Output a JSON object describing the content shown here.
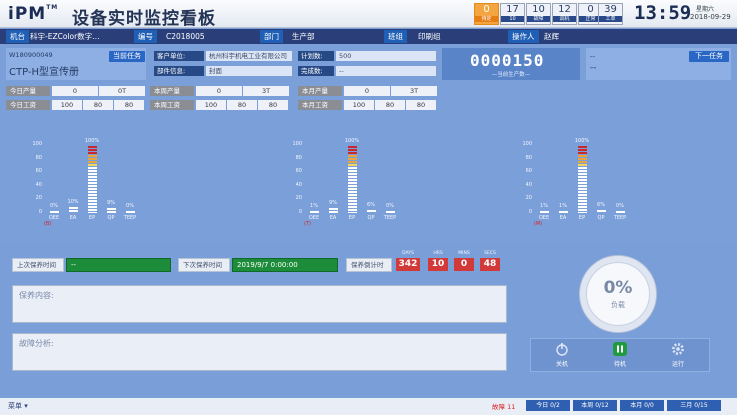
{
  "header": {
    "logo": "iPM",
    "logo_tm": "TM",
    "title": "设备实时监控看板",
    "stats": [
      {
        "value": "0",
        "label": "待定"
      },
      {
        "value": "17",
        "label": "10"
      },
      {
        "value": "10",
        "label": "故障"
      },
      {
        "value": "12",
        "label": "调机"
      },
      {
        "value": "0",
        "label": "正常"
      },
      {
        "value": "39",
        "label": "工单"
      }
    ],
    "clock": "13:59",
    "weekday": "星期六",
    "date": "2018-09-29"
  },
  "infobar": {
    "machine_label": "机台",
    "machine_value": "科宇-EZColor数字…",
    "code_label": "编号",
    "code_value": "C2018005",
    "dept_label": "部门",
    "dept_value": "生产部",
    "team_label": "班组",
    "team_value": "印刷组",
    "operator_label": "操作人",
    "operator_value": "赵辉"
  },
  "task": {
    "order_no": "W180900049",
    "current_btn": "当前任务",
    "product": "CTP-H型宣传册",
    "customer_label": "客户单位:",
    "customer_value": "杭州科宇机电工业有限公司",
    "plan_label": "计划数:",
    "plan_value": "500",
    "note_label": "部件信息:",
    "note_value": "封面",
    "done_label": "完成数:",
    "done_value": "--",
    "counter": "0000150",
    "counter_caption": "—当前生产数—",
    "next_btn": "下一任务",
    "next_line1": "--",
    "next_line2": "--"
  },
  "stats_rows": [
    {
      "label": "今日产量",
      "values": [
        "0",
        "0T"
      ]
    },
    {
      "label": "本周产量",
      "values": [
        "0",
        "3T"
      ]
    },
    {
      "label": "本月产量",
      "values": [
        "0",
        "3T"
      ]
    },
    {
      "label": "今日工资",
      "values": [
        "100",
        "80",
        "80"
      ]
    },
    {
      "label": "本周工资",
      "values": [
        "100",
        "80",
        "80"
      ]
    },
    {
      "label": "本月工资",
      "values": [
        "100",
        "80",
        "80"
      ]
    }
  ],
  "chart_data": [
    {
      "type": "bar",
      "categories": [
        "OEE",
        "EA",
        "EP",
        "QP",
        "TEEP"
      ],
      "values": [
        0,
        10,
        100,
        9,
        0
      ],
      "value_labels": [
        "0%",
        "10%",
        "100%",
        "9%",
        "0%"
      ],
      "ylim": [
        0,
        100
      ],
      "yticks": [
        "100",
        "80",
        "60",
        "40",
        "20",
        "0"
      ],
      "tag": "(B)"
    },
    {
      "type": "bar",
      "categories": [
        "OEE",
        "EA",
        "EP",
        "QP",
        "TEEP"
      ],
      "values": [
        1,
        9,
        100,
        6,
        0
      ],
      "value_labels": [
        "1%",
        "9%",
        "100%",
        "6%",
        "0%"
      ],
      "ylim": [
        0,
        100
      ],
      "yticks": [
        "100",
        "80",
        "60",
        "40",
        "20",
        "0"
      ],
      "tag": "(T)"
    },
    {
      "type": "bar",
      "categories": [
        "OEE",
        "EA",
        "EP",
        "QP",
        "TEEP"
      ],
      "values": [
        1,
        1,
        100,
        6,
        0
      ],
      "value_labels": [
        "1%",
        "1%",
        "100%",
        "6%",
        "0%"
      ],
      "ylim": [
        0,
        100
      ],
      "yticks": [
        "100",
        "80",
        "60",
        "40",
        "20",
        "0"
      ],
      "tag": "(M)"
    }
  ],
  "maintenance": {
    "last_label": "上次保养时间",
    "last_value": "--",
    "next_label": "下次保养时间",
    "next_value": "2019/9/7 0:00:00",
    "countdown_label": "保养倒计时",
    "countdown": [
      {
        "value": "342",
        "caption": "DAYS"
      },
      {
        "value": "10",
        "caption": "HRS"
      },
      {
        "value": "0",
        "caption": "MINS"
      },
      {
        "value": "48",
        "caption": "SECS"
      }
    ],
    "content_placeholder": "保养内容:",
    "analysis_placeholder": "故障分析:"
  },
  "load": {
    "percent": "0%",
    "label": "负载",
    "fill": 0
  },
  "controls": [
    {
      "label": "关机",
      "icon": "power-icon"
    },
    {
      "label": "待机",
      "icon": "pause-icon"
    },
    {
      "label": "运行",
      "icon": "gear-icon"
    }
  ],
  "footer": {
    "menu": "菜单",
    "alerts": "故障 11",
    "pills": [
      "今日 0/2",
      "本周 0/12",
      "本月 0/0",
      "三月 0/15"
    ]
  },
  "colors": {
    "background": "#7b9fd8",
    "accent": "#2a66c4",
    "header_dark": "#2a3f7a",
    "alert_red": "#d23a3a",
    "green": "#1c8c3a",
    "orange": "#f3a541"
  }
}
